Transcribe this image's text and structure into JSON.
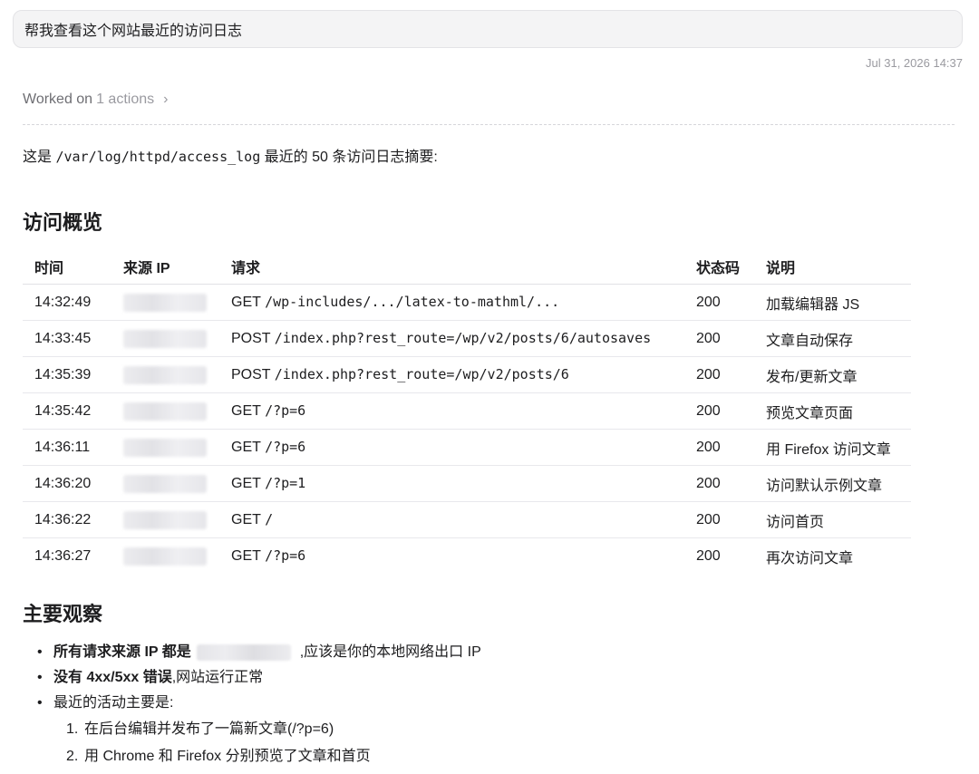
{
  "user_message": "帮我查看这个网站最近的访问日志",
  "timestamp": "Jul 31, 2026 14:37",
  "worked": {
    "prefix": "Worked on",
    "count": "1 actions",
    "chevron": "›"
  },
  "intro": {
    "before": "这是 ",
    "path": "/var/log/httpd/access_log",
    "after": " 最近的 50 条访问日志摘要:"
  },
  "overview": {
    "heading": "访问概览",
    "columns": [
      "时间",
      "来源 IP",
      "请求",
      "状态码",
      "说明"
    ],
    "rows": [
      {
        "time": "14:32:49",
        "method": "GET",
        "path": "/wp-includes/.../latex-to-mathml/...",
        "status": "200",
        "note": "加载编辑器 JS"
      },
      {
        "time": "14:33:45",
        "method": "POST",
        "path": "/index.php?rest_route=/wp/v2/posts/6/autosaves",
        "status": "200",
        "note": "文章自动保存"
      },
      {
        "time": "14:35:39",
        "method": "POST",
        "path": "/index.php?rest_route=/wp/v2/posts/6",
        "status": "200",
        "note": "发布/更新文章"
      },
      {
        "time": "14:35:42",
        "method": "GET",
        "path": "/?p=6",
        "status": "200",
        "note": "预览文章页面"
      },
      {
        "time": "14:36:11",
        "method": "GET",
        "path": "/?p=6",
        "status": "200",
        "note": "用 Firefox 访问文章"
      },
      {
        "time": "14:36:20",
        "method": "GET",
        "path": "/?p=1",
        "status": "200",
        "note": "访问默认示例文章"
      },
      {
        "time": "14:36:22",
        "method": "GET",
        "path": "/",
        "status": "200",
        "note": "访问首页"
      },
      {
        "time": "14:36:27",
        "method": "GET",
        "path": "/?p=6",
        "status": "200",
        "note": "再次访问文章"
      }
    ]
  },
  "observations": {
    "heading": "主要观察",
    "items": [
      {
        "bold": "所有请求来源 IP 都是",
        "text": ",应该是你的本地网络出口 IP"
      },
      {
        "bold": "没有 4xx/5xx 错误",
        "text": ",网站运行正常"
      },
      {
        "bold": "",
        "text": "最近的活动主要是:"
      }
    ],
    "sub_items": [
      {
        "num": "1.",
        "text": "在后台编辑并发布了一篇新文章(/?p=6)"
      },
      {
        "num": "2.",
        "text": "用 Chrome 和 Firefox 分别预览了文章和首页"
      }
    ]
  }
}
